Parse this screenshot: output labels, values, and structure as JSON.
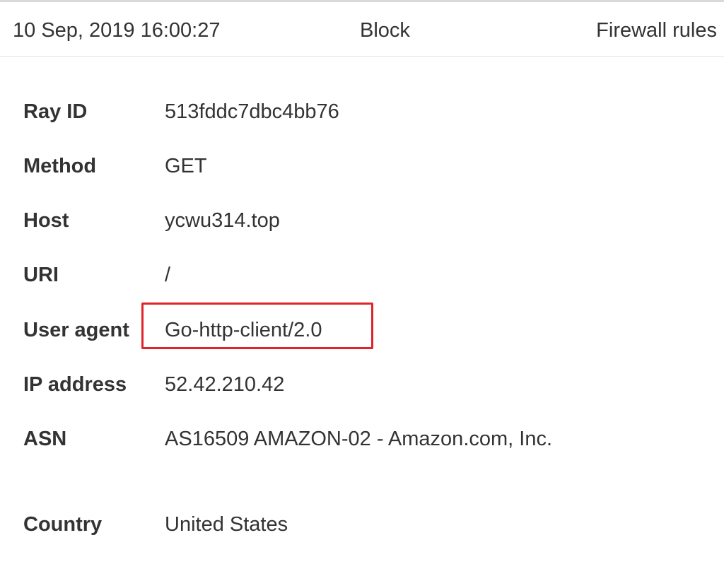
{
  "summary": {
    "date": "10 Sep, 2019 16:00:27",
    "action": "Block",
    "service": "Firewall rules"
  },
  "details": [
    {
      "label": "Ray ID",
      "value": "513fddc7dbc4bb76"
    },
    {
      "label": "Method",
      "value": "GET"
    },
    {
      "label": "Host",
      "value": "ycwu314.top"
    },
    {
      "label": "URI",
      "value": "/"
    },
    {
      "label": "User agent",
      "value": "Go-http-client/2.0"
    },
    {
      "label": "IP address",
      "value": "52.42.210.42"
    },
    {
      "label": "ASN",
      "value": "AS16509 AMAZON-02 - Amazon.com, Inc."
    },
    {
      "label": "Country",
      "value": "United States"
    }
  ],
  "colors": {
    "highlight": "#e0242b",
    "text": "#333333"
  }
}
